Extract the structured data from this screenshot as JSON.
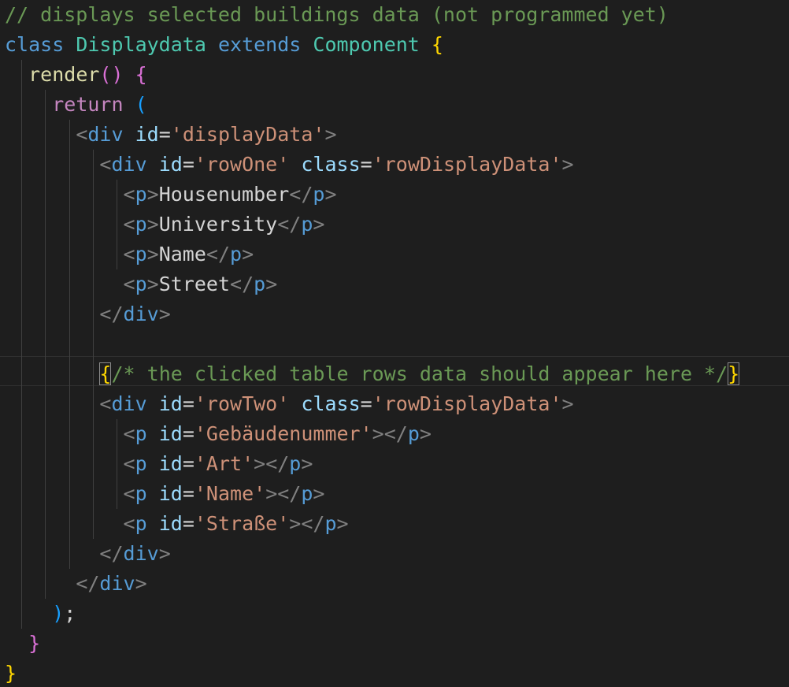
{
  "theme": {
    "background": "#1e1e1e",
    "comment": "#6a9955",
    "keyword_storage": "#569cd6",
    "keyword_control": "#c586c0",
    "class_name": "#4ec9b0",
    "function": "#dcdcaa",
    "string": "#ce9178",
    "attribute": "#9cdcfe",
    "tag": "#569cd6",
    "tag_angle": "#808080",
    "text": "#d4d4d4",
    "bracket_gold": "#ffd700",
    "bracket_magenta": "#da70d6",
    "bracket_blue": "#179fff"
  },
  "lines": [
    [
      [
        "// displays selected buildings data (not programmed yet)",
        "comment"
      ]
    ],
    [
      [
        "class",
        "keyword_storage"
      ],
      [
        " ",
        "text"
      ],
      [
        "Displaydata",
        "class_name"
      ],
      [
        " ",
        "text"
      ],
      [
        "extends",
        "keyword_storage"
      ],
      [
        " ",
        "text"
      ],
      [
        "Component",
        "class_name"
      ],
      [
        " ",
        "text"
      ],
      [
        "{",
        "bracket_gold"
      ]
    ],
    [
      [
        "  ",
        "text"
      ],
      [
        "render",
        "function"
      ],
      [
        "()",
        "bracket_magenta"
      ],
      [
        " ",
        "text"
      ],
      [
        "{",
        "bracket_magenta"
      ]
    ],
    [
      [
        "    ",
        "text"
      ],
      [
        "return",
        "keyword_control"
      ],
      [
        " ",
        "text"
      ],
      [
        "(",
        "bracket_blue"
      ]
    ],
    [
      [
        "      ",
        "text"
      ],
      [
        "<",
        "tag_angle"
      ],
      [
        "div",
        "tag"
      ],
      [
        " ",
        "text"
      ],
      [
        "id",
        "attribute"
      ],
      [
        "=",
        "text"
      ],
      [
        "'displayData'",
        "string"
      ],
      [
        ">",
        "tag_angle"
      ]
    ],
    [
      [
        "        ",
        "text"
      ],
      [
        "<",
        "tag_angle"
      ],
      [
        "div",
        "tag"
      ],
      [
        " ",
        "text"
      ],
      [
        "id",
        "attribute"
      ],
      [
        "=",
        "text"
      ],
      [
        "'rowOne'",
        "string"
      ],
      [
        " ",
        "text"
      ],
      [
        "class",
        "attribute"
      ],
      [
        "=",
        "text"
      ],
      [
        "'rowDisplayData'",
        "string"
      ],
      [
        ">",
        "tag_angle"
      ]
    ],
    [
      [
        "          ",
        "text"
      ],
      [
        "<",
        "tag_angle"
      ],
      [
        "p",
        "tag"
      ],
      [
        ">",
        "tag_angle"
      ],
      [
        "Housenumber",
        "text"
      ],
      [
        "</",
        "tag_angle"
      ],
      [
        "p",
        "tag"
      ],
      [
        ">",
        "tag_angle"
      ]
    ],
    [
      [
        "          ",
        "text"
      ],
      [
        "<",
        "tag_angle"
      ],
      [
        "p",
        "tag"
      ],
      [
        ">",
        "tag_angle"
      ],
      [
        "University",
        "text"
      ],
      [
        "</",
        "tag_angle"
      ],
      [
        "p",
        "tag"
      ],
      [
        ">",
        "tag_angle"
      ]
    ],
    [
      [
        "          ",
        "text"
      ],
      [
        "<",
        "tag_angle"
      ],
      [
        "p",
        "tag"
      ],
      [
        ">",
        "tag_angle"
      ],
      [
        "Name",
        "text"
      ],
      [
        "</",
        "tag_angle"
      ],
      [
        "p",
        "tag"
      ],
      [
        ">",
        "tag_angle"
      ]
    ],
    [
      [
        "          ",
        "text"
      ],
      [
        "<",
        "tag_angle"
      ],
      [
        "p",
        "tag"
      ],
      [
        ">",
        "tag_angle"
      ],
      [
        "Street",
        "text"
      ],
      [
        "</",
        "tag_angle"
      ],
      [
        "p",
        "tag"
      ],
      [
        ">",
        "tag_angle"
      ]
    ],
    [
      [
        "        ",
        "text"
      ],
      [
        "</",
        "tag_angle"
      ],
      [
        "div",
        "tag"
      ],
      [
        ">",
        "tag_angle"
      ]
    ],
    [],
    [
      [
        "        ",
        "text"
      ],
      [
        "{",
        "bracket_gold",
        "match"
      ],
      [
        "/* the clicked table rows data should appear here */",
        "comment"
      ],
      [
        "}",
        "bracket_gold",
        "match"
      ]
    ],
    [
      [
        "        ",
        "text"
      ],
      [
        "<",
        "tag_angle"
      ],
      [
        "div",
        "tag"
      ],
      [
        " ",
        "text"
      ],
      [
        "id",
        "attribute"
      ],
      [
        "=",
        "text"
      ],
      [
        "'rowTwo'",
        "string"
      ],
      [
        " ",
        "text"
      ],
      [
        "class",
        "attribute"
      ],
      [
        "=",
        "text"
      ],
      [
        "'rowDisplayData'",
        "string"
      ],
      [
        ">",
        "tag_angle"
      ]
    ],
    [
      [
        "          ",
        "text"
      ],
      [
        "<",
        "tag_angle"
      ],
      [
        "p",
        "tag"
      ],
      [
        " ",
        "text"
      ],
      [
        "id",
        "attribute"
      ],
      [
        "=",
        "text"
      ],
      [
        "'Gebäudenummer'",
        "string"
      ],
      [
        "></",
        "tag_angle"
      ],
      [
        "p",
        "tag"
      ],
      [
        ">",
        "tag_angle"
      ]
    ],
    [
      [
        "          ",
        "text"
      ],
      [
        "<",
        "tag_angle"
      ],
      [
        "p",
        "tag"
      ],
      [
        " ",
        "text"
      ],
      [
        "id",
        "attribute"
      ],
      [
        "=",
        "text"
      ],
      [
        "'Art'",
        "string"
      ],
      [
        "></",
        "tag_angle"
      ],
      [
        "p",
        "tag"
      ],
      [
        ">",
        "tag_angle"
      ]
    ],
    [
      [
        "          ",
        "text"
      ],
      [
        "<",
        "tag_angle"
      ],
      [
        "p",
        "tag"
      ],
      [
        " ",
        "text"
      ],
      [
        "id",
        "attribute"
      ],
      [
        "=",
        "text"
      ],
      [
        "'Name'",
        "string"
      ],
      [
        "></",
        "tag_angle"
      ],
      [
        "p",
        "tag"
      ],
      [
        ">",
        "tag_angle"
      ]
    ],
    [
      [
        "          ",
        "text"
      ],
      [
        "<",
        "tag_angle"
      ],
      [
        "p",
        "tag"
      ],
      [
        " ",
        "text"
      ],
      [
        "id",
        "attribute"
      ],
      [
        "=",
        "text"
      ],
      [
        "'Straße'",
        "string"
      ],
      [
        "></",
        "tag_angle"
      ],
      [
        "p",
        "tag"
      ],
      [
        ">",
        "tag_angle"
      ]
    ],
    [
      [
        "        ",
        "text"
      ],
      [
        "</",
        "tag_angle"
      ],
      [
        "div",
        "tag"
      ],
      [
        ">",
        "tag_angle"
      ]
    ],
    [
      [
        "      ",
        "text"
      ],
      [
        "</",
        "tag_angle"
      ],
      [
        "div",
        "tag"
      ],
      [
        ">",
        "tag_angle"
      ]
    ],
    [
      [
        "    ",
        "text"
      ],
      [
        ")",
        "bracket_blue"
      ],
      [
        ";",
        "text"
      ]
    ],
    [
      [
        "  ",
        "text"
      ],
      [
        "}",
        "bracket_magenta"
      ]
    ],
    [
      [
        "}",
        "bracket_gold"
      ]
    ]
  ]
}
